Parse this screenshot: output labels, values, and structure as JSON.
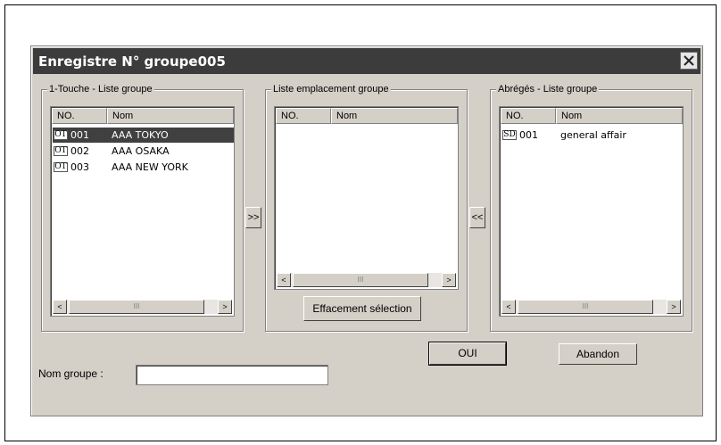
{
  "dialog": {
    "title": "Enregistre N° groupe005",
    "close_glyph": "close-icon"
  },
  "onetouch": {
    "label": "1-Touche - Liste groupe",
    "columns": [
      "NO.",
      "Nom"
    ],
    "rows": [
      {
        "badge": "OT",
        "no": "001",
        "name": "AAA TOKYO",
        "selected": true
      },
      {
        "badge": "OT",
        "no": "002",
        "name": "AAA OSAKA",
        "selected": false
      },
      {
        "badge": "OT",
        "no": "003",
        "name": "AAA NEW YORK",
        "selected": false
      }
    ]
  },
  "location": {
    "label": "Liste emplacement groupe",
    "columns": [
      "NO.",
      "Nom"
    ],
    "rows": [],
    "clear_button": "Effacement sélection"
  },
  "abbrev": {
    "label": "Abrégés - Liste groupe",
    "columns": [
      "NO.",
      "Nom"
    ],
    "rows": [
      {
        "badge": "SD",
        "no": "001",
        "name": "general affair",
        "selected": false
      }
    ]
  },
  "buttons": {
    "add_right": ">>",
    "add_left": "<<",
    "ok": "OUI",
    "cancel": "Abandon"
  },
  "scroll_glyphs": {
    "left": "<",
    "right": ">",
    "thumb": "III"
  },
  "group_name": {
    "label": "Nom groupe :",
    "value": ""
  }
}
